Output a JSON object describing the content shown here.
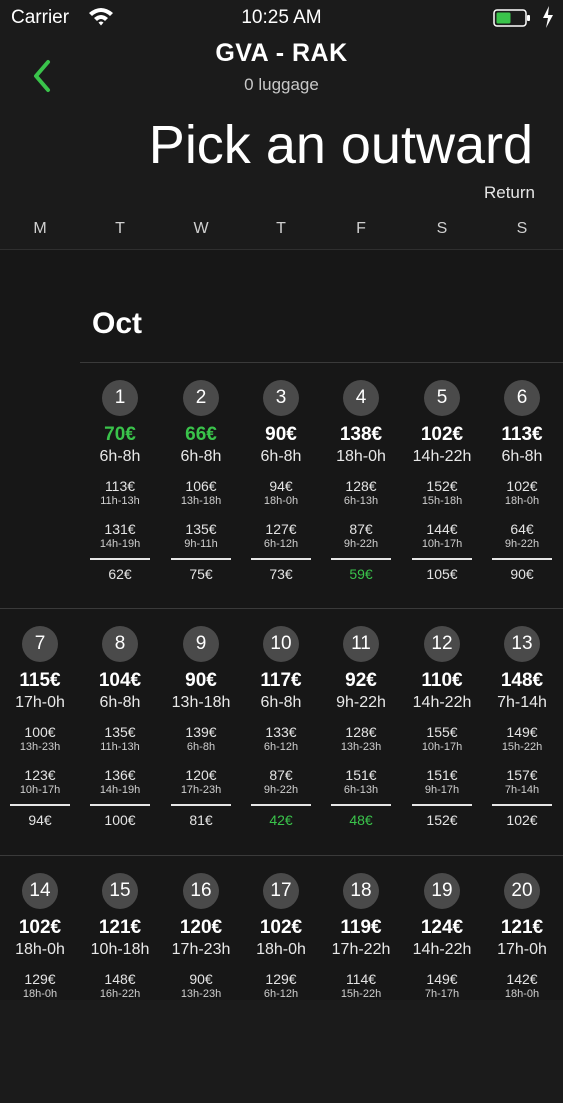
{
  "status_bar": {
    "carrier": "Carrier",
    "time": "10:25 AM"
  },
  "header": {
    "route": "GVA - RAK",
    "luggage": "0 luggage",
    "title": "Pick an outward",
    "return_label": "Return"
  },
  "weekdays": [
    "M",
    "T",
    "W",
    "T",
    "F",
    "S",
    "S"
  ],
  "calendar": {
    "month": "Oct",
    "weeks": [
      [
        null,
        {
          "day": "1",
          "price": "70€",
          "hours": "6h-8h",
          "alt1_price": "113€",
          "alt1_hours": "11h-13h",
          "alt2_price": "131€",
          "alt2_hours": "14h-19h",
          "return_price": "62€",
          "price_highlight": true,
          "return_highlight": false
        },
        {
          "day": "2",
          "price": "66€",
          "hours": "6h-8h",
          "alt1_price": "106€",
          "alt1_hours": "13h-18h",
          "alt2_price": "135€",
          "alt2_hours": "9h-11h",
          "return_price": "75€",
          "price_highlight": true,
          "return_highlight": false
        },
        {
          "day": "3",
          "price": "90€",
          "hours": "6h-8h",
          "alt1_price": "94€",
          "alt1_hours": "18h-0h",
          "alt2_price": "127€",
          "alt2_hours": "6h-12h",
          "return_price": "73€",
          "price_highlight": false,
          "return_highlight": false
        },
        {
          "day": "4",
          "price": "138€",
          "hours": "18h-0h",
          "alt1_price": "128€",
          "alt1_hours": "6h-13h",
          "alt2_price": "87€",
          "alt2_hours": "9h-22h",
          "return_price": "59€",
          "price_highlight": false,
          "return_highlight": true
        },
        {
          "day": "5",
          "price": "102€",
          "hours": "14h-22h",
          "alt1_price": "152€",
          "alt1_hours": "15h-18h",
          "alt2_price": "144€",
          "alt2_hours": "10h-17h",
          "return_price": "105€",
          "price_highlight": false,
          "return_highlight": false
        },
        {
          "day": "6",
          "price": "113€",
          "hours": "6h-8h",
          "alt1_price": "102€",
          "alt1_hours": "18h-0h",
          "alt2_price": "64€",
          "alt2_hours": "9h-22h",
          "return_price": "90€",
          "price_highlight": false,
          "return_highlight": false
        }
      ],
      [
        {
          "day": "7",
          "price": "115€",
          "hours": "17h-0h",
          "alt1_price": "100€",
          "alt1_hours": "13h-23h",
          "alt2_price": "123€",
          "alt2_hours": "10h-17h",
          "return_price": "94€",
          "price_highlight": false,
          "return_highlight": false
        },
        {
          "day": "8",
          "price": "104€",
          "hours": "6h-8h",
          "alt1_price": "135€",
          "alt1_hours": "11h-13h",
          "alt2_price": "136€",
          "alt2_hours": "14h-19h",
          "return_price": "100€",
          "price_highlight": false,
          "return_highlight": false
        },
        {
          "day": "9",
          "price": "90€",
          "hours": "13h-18h",
          "alt1_price": "139€",
          "alt1_hours": "6h-8h",
          "alt2_price": "120€",
          "alt2_hours": "17h-23h",
          "return_price": "81€",
          "price_highlight": false,
          "return_highlight": false
        },
        {
          "day": "10",
          "price": "117€",
          "hours": "6h-8h",
          "alt1_price": "133€",
          "alt1_hours": "6h-12h",
          "alt2_price": "87€",
          "alt2_hours": "9h-22h",
          "return_price": "42€",
          "price_highlight": false,
          "return_highlight": true
        },
        {
          "day": "11",
          "price": "92€",
          "hours": "9h-22h",
          "alt1_price": "128€",
          "alt1_hours": "13h-23h",
          "alt2_price": "151€",
          "alt2_hours": "6h-13h",
          "return_price": "48€",
          "price_highlight": false,
          "return_highlight": true
        },
        {
          "day": "12",
          "price": "110€",
          "hours": "14h-22h",
          "alt1_price": "155€",
          "alt1_hours": "10h-17h",
          "alt2_price": "151€",
          "alt2_hours": "9h-17h",
          "return_price": "152€",
          "price_highlight": false,
          "return_highlight": false
        },
        {
          "day": "13",
          "price": "148€",
          "hours": "7h-14h",
          "alt1_price": "149€",
          "alt1_hours": "15h-22h",
          "alt2_price": "157€",
          "alt2_hours": "7h-14h",
          "return_price": "102€",
          "price_highlight": false,
          "return_highlight": false
        }
      ],
      [
        {
          "day": "14",
          "price": "102€",
          "hours": "18h-0h",
          "alt1_price": "129€",
          "alt1_hours": "18h-0h",
          "alt2_price": "",
          "alt2_hours": "",
          "return_price": "",
          "price_highlight": false,
          "return_highlight": false
        },
        {
          "day": "15",
          "price": "121€",
          "hours": "10h-18h",
          "alt1_price": "148€",
          "alt1_hours": "16h-22h",
          "alt2_price": "",
          "alt2_hours": "",
          "return_price": "",
          "price_highlight": false,
          "return_highlight": false
        },
        {
          "day": "16",
          "price": "120€",
          "hours": "17h-23h",
          "alt1_price": "90€",
          "alt1_hours": "13h-23h",
          "alt2_price": "",
          "alt2_hours": "",
          "return_price": "",
          "price_highlight": false,
          "return_highlight": false
        },
        {
          "day": "17",
          "price": "102€",
          "hours": "18h-0h",
          "alt1_price": "129€",
          "alt1_hours": "6h-12h",
          "alt2_price": "",
          "alt2_hours": "",
          "return_price": "",
          "price_highlight": false,
          "return_highlight": false
        },
        {
          "day": "18",
          "price": "119€",
          "hours": "17h-22h",
          "alt1_price": "114€",
          "alt1_hours": "15h-22h",
          "alt2_price": "",
          "alt2_hours": "",
          "return_price": "",
          "price_highlight": false,
          "return_highlight": false
        },
        {
          "day": "19",
          "price": "124€",
          "hours": "14h-22h",
          "alt1_price": "149€",
          "alt1_hours": "7h-17h",
          "alt2_price": "",
          "alt2_hours": "",
          "return_price": "",
          "price_highlight": false,
          "return_highlight": false
        },
        {
          "day": "20",
          "price": "121€",
          "hours": "17h-0h",
          "alt1_price": "142€",
          "alt1_hours": "18h-0h",
          "alt2_price": "",
          "alt2_hours": "",
          "return_price": "",
          "price_highlight": false,
          "return_highlight": false
        }
      ]
    ]
  },
  "colors": {
    "background": "#1b1b1b",
    "accent_green": "#3ac34b",
    "day_circle": "#4a4a4a"
  }
}
